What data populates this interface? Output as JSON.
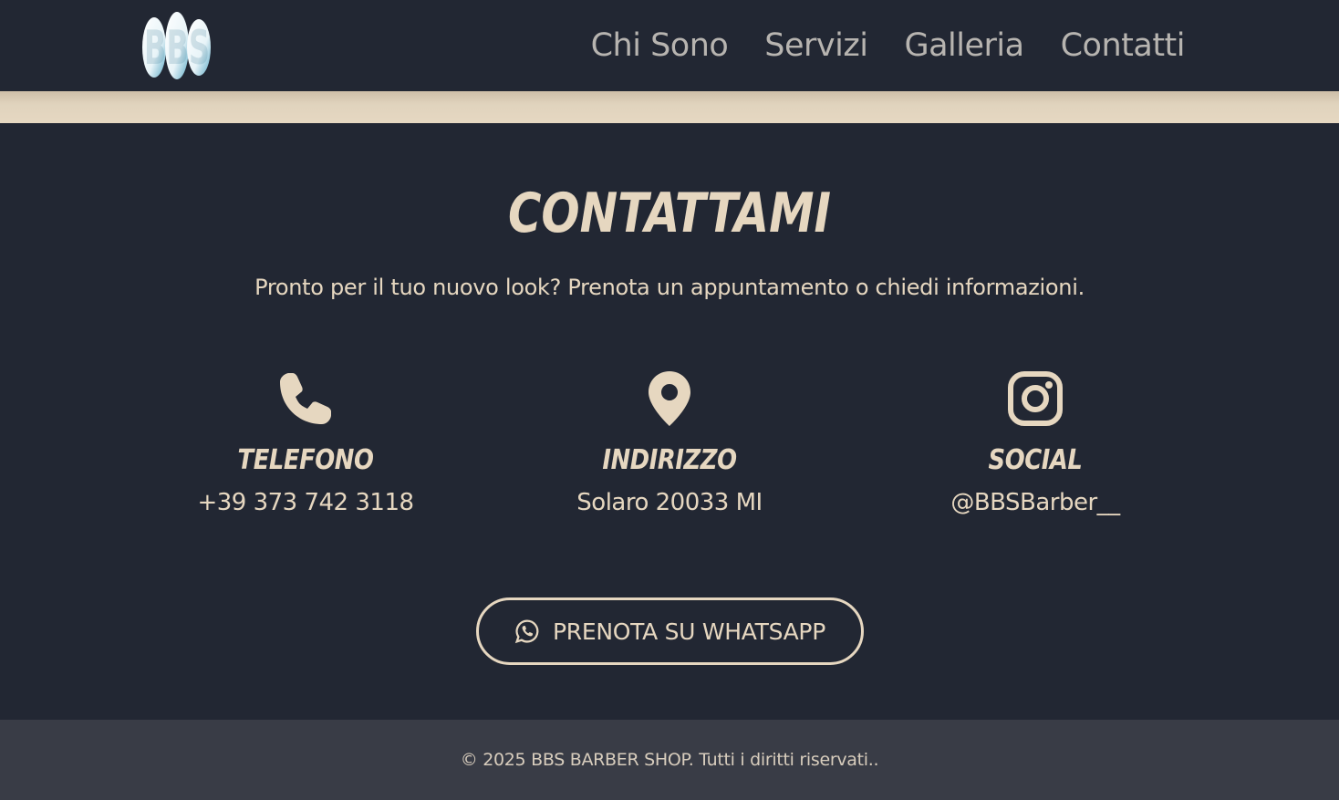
{
  "header": {
    "logo_text": "BBS",
    "nav": [
      {
        "label": "Chi Sono"
      },
      {
        "label": "Servizi"
      },
      {
        "label": "Galleria"
      },
      {
        "label": "Contatti"
      }
    ]
  },
  "contact": {
    "title": "CONTATTAMI",
    "subtitle": "Pronto per il tuo nuovo look? Prenota un appuntamento o chiedi informazioni.",
    "cards": [
      {
        "icon": "phone-icon",
        "label": "TELEFONO",
        "value": "+39 373 742 3118"
      },
      {
        "icon": "map-pin-icon",
        "label": "INDIRIZZO",
        "value": "Solaro 20033 MI"
      },
      {
        "icon": "instagram-icon",
        "label": "SOCIAL",
        "value": "@BBSBarber__"
      }
    ],
    "whatsapp_button": "PRENOTA SU WHATSAPP"
  },
  "footer": {
    "text": "© 2025 BBS BARBER SHOP. Tutti i diritti riservati.."
  },
  "colors": {
    "background": "#222733",
    "accent": "#e6d7c0",
    "nav_text": "#b7b4b0",
    "footer_bg": "#393c46"
  }
}
